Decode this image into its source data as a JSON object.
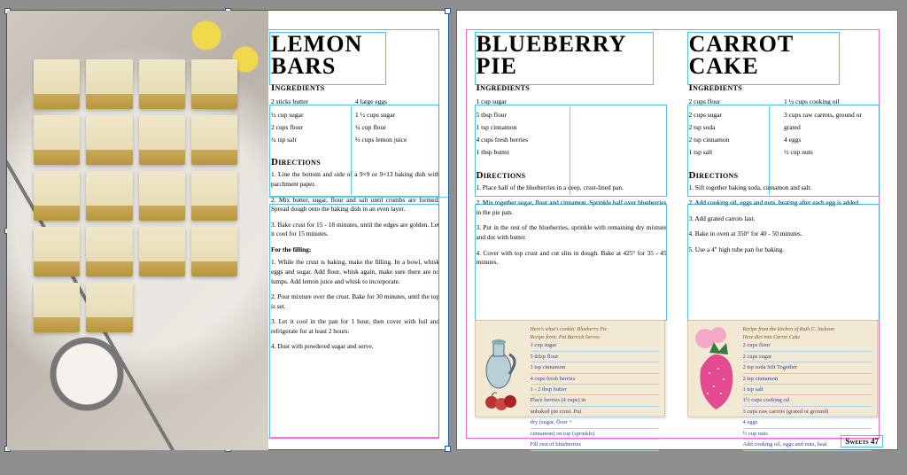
{
  "footer": "Sweets 47",
  "recipes": {
    "lemon": {
      "title_l1": "LEMON",
      "title_l2": "BARS",
      "ingredients_head": "Ingredients",
      "ing_col1": [
        "2 sticks butter",
        "½ cup sugar",
        "2 cups flour",
        "¼ tsp salt"
      ],
      "ing_col2": [
        "4 large eggs",
        "1 ½ cups sugar",
        "¼ cup flour",
        "⅔ cups lemon juice"
      ],
      "directions_head": "Directions",
      "steps": [
        "1. Line the bottom and side of a 9×9 or 9×13 baking dish with parchment paper.",
        "2. Mix butter, sugar, flour and salt until crumbs are formed. Spread dough onto the baking dish in an even layer.",
        "3. Bake crust for 15 - 18 minutes, until the edges are golden. Let it cool for 15 minutes."
      ],
      "subhead": "For the filling:",
      "steps2": [
        "1. While the crust is baking, make the filling. In a bowl, whisk eggs and sugar. Add flour, whisk again, make sure there are no lumps. Add lemon juice and whisk to incorporate.",
        "2. Pour mixture over the crust. Bake for 30 minutes, until the top is set.",
        "3. Let it cool in the pan for 1 hour, then cover with foil and refrigerate for at least 2 hours.",
        "4. Dust with powdered sugar and serve."
      ]
    },
    "blueberry": {
      "title_l1": "BLUEBERRY",
      "title_l2": "PIE",
      "ingredients_head": "Ingredients",
      "ing_col1": [
        "1 cup sugar",
        "5 tbsp flour",
        "1 tsp cinnamon",
        "4 cups fresh berries",
        "1 tbsp butter"
      ],
      "directions_head": "Directions",
      "steps": [
        "1. Place half of the blueberries in a deep, crust-lined pan.",
        "2. Mix together sugar, flour and cinnamon. Sprinkle half over blueberries in the pie pan.",
        "3. Put in the rest of the blueberries, sprinkle with remaining dry mixture and dot with butter.",
        "4. Cover with top crust and cut slits in dough. Bake at 425° for 35 - 45 minutes."
      ],
      "card_header": "Here's what's cookin:",
      "card_title": "Blueberry Pie",
      "card_from": "Recipe from: Pat Barrick   Serves:",
      "card_lines": [
        "1 cup sugar",
        "5 tblsp flour",
        "1 tsp cinnamon",
        "4 cups fresh berries",
        "1 - 2 tbsp butter",
        "Place berries (4 cups) in",
        "unbaked pie crust. Put",
        "dry (sugar, flour +",
        "cinnamon) on top (sprinkle)",
        "Fill rest of blueberries"
      ]
    },
    "carrot": {
      "title_l1": "CARROT",
      "title_l2": "CAKE",
      "ingredients_head": "Ingredients",
      "ing_col1": [
        "2 cups flour",
        "2 cups sugar",
        "2 tsp soda",
        "2 tsp cinnamon",
        "1 tsp salt"
      ],
      "ing_col2": [
        "1 ½ cups cooking oil",
        "3 cups raw carrots, ground or grated",
        "4 eggs",
        "½ cup nuts"
      ],
      "directions_head": "Directions",
      "steps": [
        "1. Sift together baking soda, cinnamon and salt.",
        "2. Add cooking oil, eggs and nuts, beating after each egg is added.",
        "3. Add grated carrots last.",
        "4. Bake in oven at 350° for 40 - 50 minutes.",
        "5. Use a 4\" high tube pan for baking."
      ],
      "card_header": "Recipe from the kitchen of Ruth C. Jackson",
      "card_sub": "Here dict into Carrot Cake",
      "card_lines": [
        "2 cups flour",
        "2 cups sugar",
        "2 tsp soda      Sift Together",
        "2 tsp cinnamon",
        "1 tsp salt",
        "1½ cups cooking oil",
        "3 cups raw carrots (grated or ground)",
        "4 eggs",
        "½ cup nuts",
        "Add cooking oil, eggs and nuts, beat"
      ]
    }
  }
}
